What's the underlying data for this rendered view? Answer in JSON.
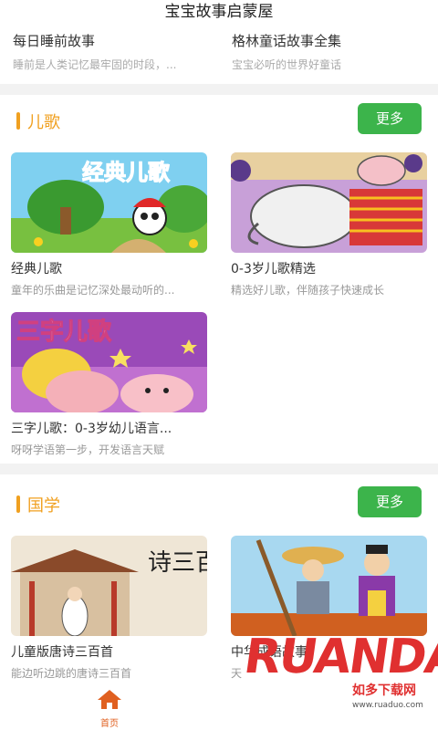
{
  "app": {
    "title": "宝宝故事启蒙屋"
  },
  "top_items": [
    {
      "title": "每日睡前故事",
      "desc": "睡前是人类记忆最牢固的时段，..."
    },
    {
      "title": "格林童话故事全集",
      "desc": "宝宝必听的世界好童话"
    }
  ],
  "sections": [
    {
      "title": "儿歌",
      "more": "更多",
      "cards": [
        {
          "title": "经典儿歌",
          "desc": "童年的乐曲是记忆深处最动听的...",
          "thumb_text": "经典儿歌"
        },
        {
          "title": "0-3岁儿歌精选",
          "desc": "精选好儿歌，伴随孩子快速成长"
        },
        {
          "title": "三字儿歌：0-3岁幼儿语言...",
          "desc": "呀呀学语第一步，开发语言天赋",
          "thumb_text": "三字儿歌"
        }
      ]
    },
    {
      "title": "国学",
      "more": "更多",
      "cards": [
        {
          "title": "儿童版唐诗三百首",
          "desc": "能边听边跳的唐诗三百首",
          "thumb_text": "诗三百首"
        },
        {
          "title": "中华成语故事",
          "desc": "天"
        }
      ]
    }
  ],
  "tabbar": {
    "home_label": "首页"
  },
  "watermark": {
    "brand": "RUANDADO",
    "site": "如多下载网",
    "url": "www.ruaduo.com"
  },
  "colors": {
    "accent": "#f0a020",
    "button": "#3cb44b",
    "tab_active": "#e06020"
  }
}
